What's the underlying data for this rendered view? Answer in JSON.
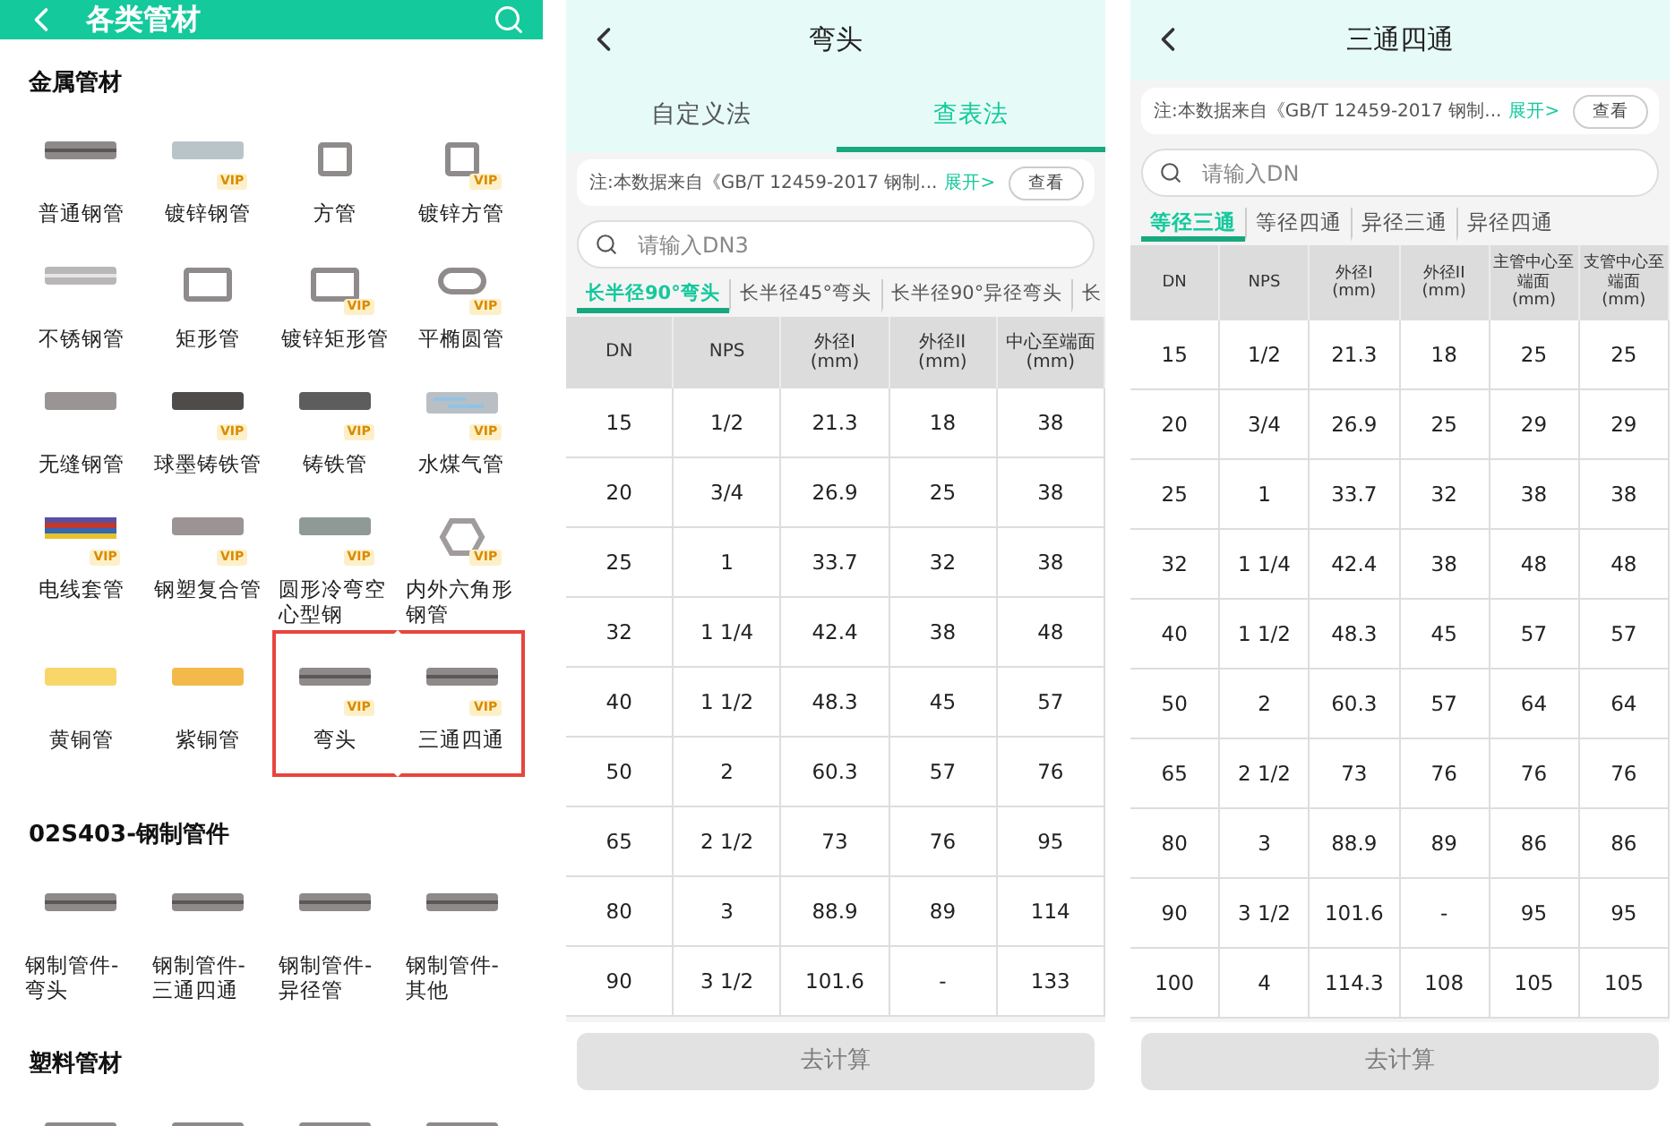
{
  "catalog": {
    "title": "各类管材",
    "sections": [
      {
        "title": "金属管材",
        "items": [
          {
            "label": "普通钢管",
            "highlighted": false
          },
          {
            "label": "镀锌钢管",
            "badge": "VIP",
            "highlighted": false
          },
          {
            "label": "方管",
            "highlighted": false
          },
          {
            "label": "镀锌方管",
            "badge": "VIP",
            "highlighted": false
          },
          {
            "label": "不锈钢管",
            "highlighted": false
          },
          {
            "label": "矩形管",
            "highlighted": false
          },
          {
            "label": "镀锌矩形管",
            "badge": "VIP",
            "highlighted": false
          },
          {
            "label": "平椭圆管",
            "badge": "VIP",
            "highlighted": false
          },
          {
            "label": "无缝钢管",
            "highlighted": false
          },
          {
            "label": "球墨铸铁管",
            "badge": "VIP",
            "highlighted": false
          },
          {
            "label": "铸铁管",
            "badge": "VIP",
            "highlighted": false
          },
          {
            "label": "水煤气管",
            "badge": "VIP",
            "highlighted": false
          },
          {
            "label": "电线套管",
            "badge": "VIP",
            "highlighted": false
          },
          {
            "label": "钢塑复合管",
            "badge": "VIP",
            "highlighted": false
          },
          {
            "label": "圆形冷弯空心型钢",
            "badge": "VIP",
            "highlighted": false
          },
          {
            "label": "内外六角形钢管",
            "badge": "VIP",
            "highlighted": false
          },
          {
            "label": "黄铜管",
            "highlighted": false
          },
          {
            "label": "紫铜管",
            "highlighted": false
          },
          {
            "label": "弯头",
            "badge": "VIP",
            "highlighted": true
          },
          {
            "label": "三通四通",
            "badge": "VIP",
            "highlighted": true
          }
        ]
      },
      {
        "title": "02S403-钢制管件",
        "items": [
          {
            "label": "钢制管件-弯头",
            "highlighted": false
          },
          {
            "label": "钢制管件-三通四通",
            "highlighted": false
          },
          {
            "label": "钢制管件-异径管",
            "highlighted": false
          },
          {
            "label": "钢制管件-其他",
            "highlighted": false
          }
        ]
      },
      {
        "title": "塑料管材",
        "items": [
          {
            "highlighted": false
          },
          {
            "highlighted": false
          },
          {
            "highlighted": false
          },
          {
            "highlighted": false
          }
        ]
      }
    ]
  },
  "elbow": {
    "title": "弯头",
    "segments": [
      {
        "label": "自定义法",
        "selected": false
      },
      {
        "label": "查表法",
        "selected": true
      }
    ],
    "note": "注:本数据来自《GB/T 12459-2017 钢制...",
    "note_link": "展开>",
    "note_button": "查看",
    "search": {
      "placeholder": "请输入DN3"
    },
    "tabs": [
      {
        "label": "长半径90°弯头",
        "selected": true
      },
      {
        "label": "长半径45°弯头",
        "selected": false
      },
      {
        "label": "长半径90°异径弯头",
        "selected": false
      },
      {
        "label": "长",
        "selected": false
      }
    ],
    "table": {
      "columns": [
        {
          "label": "DN"
        },
        {
          "label": "NPS"
        },
        {
          "label": "外径I",
          "unit": "(mm)"
        },
        {
          "label": "外径II",
          "unit": "(mm)"
        },
        {
          "label": "中心至端面",
          "unit": "(mm)"
        }
      ],
      "rows": [
        [
          "15",
          "1/2",
          "21.3",
          "18",
          "38"
        ],
        [
          "20",
          "3/4",
          "26.9",
          "25",
          "38"
        ],
        [
          "25",
          "1",
          "33.7",
          "32",
          "38"
        ],
        [
          "32",
          "1 1/4",
          "42.4",
          "38",
          "48"
        ],
        [
          "40",
          "1 1/2",
          "48.3",
          "45",
          "57"
        ],
        [
          "50",
          "2",
          "60.3",
          "57",
          "76"
        ],
        [
          "65",
          "2 1/2",
          "73",
          "76",
          "95"
        ],
        [
          "80",
          "3",
          "88.9",
          "89",
          "114"
        ],
        [
          "90",
          "3 1/2",
          "101.6",
          "-",
          "133"
        ]
      ]
    },
    "button": {
      "label": "去计算",
      "disabled": true
    }
  },
  "tee": {
    "title": "三通四通",
    "note": "注:本数据来自《GB/T 12459-2017 钢制...",
    "note_link": "展开>",
    "note_button": "查看",
    "search": {
      "placeholder": "请输入DN"
    },
    "tabs": [
      {
        "label": "等径三通",
        "selected": true
      },
      {
        "label": "等径四通",
        "selected": false
      },
      {
        "label": "异径三通",
        "selected": false
      },
      {
        "label": "异径四通",
        "selected": false
      }
    ],
    "table": {
      "columns": [
        {
          "label": "DN"
        },
        {
          "label": "NPS"
        },
        {
          "label": "外径I",
          "unit": "(mm)"
        },
        {
          "label": "外径II",
          "unit": "(mm)"
        },
        {
          "label": "主管中心至端面",
          "unit": "(mm)"
        },
        {
          "label": "支管中心至端面",
          "unit": "(mm)"
        }
      ],
      "rows": [
        [
          "15",
          "1/2",
          "21.3",
          "18",
          "25",
          "25"
        ],
        [
          "20",
          "3/4",
          "26.9",
          "25",
          "29",
          "29"
        ],
        [
          "25",
          "1",
          "33.7",
          "32",
          "38",
          "38"
        ],
        [
          "32",
          "1 1/4",
          "42.4",
          "38",
          "48",
          "48"
        ],
        [
          "40",
          "1 1/2",
          "48.3",
          "45",
          "57",
          "57"
        ],
        [
          "50",
          "2",
          "60.3",
          "57",
          "64",
          "64"
        ],
        [
          "65",
          "2 1/2",
          "73",
          "76",
          "76",
          "76"
        ],
        [
          "80",
          "3",
          "88.9",
          "89",
          "86",
          "86"
        ],
        [
          "90",
          "3 1/2",
          "101.6",
          "-",
          "95",
          "95"
        ],
        [
          "100",
          "4",
          "114.3",
          "108",
          "105",
          "105"
        ]
      ]
    },
    "button": {
      "label": "去计算",
      "disabled": true
    }
  }
}
